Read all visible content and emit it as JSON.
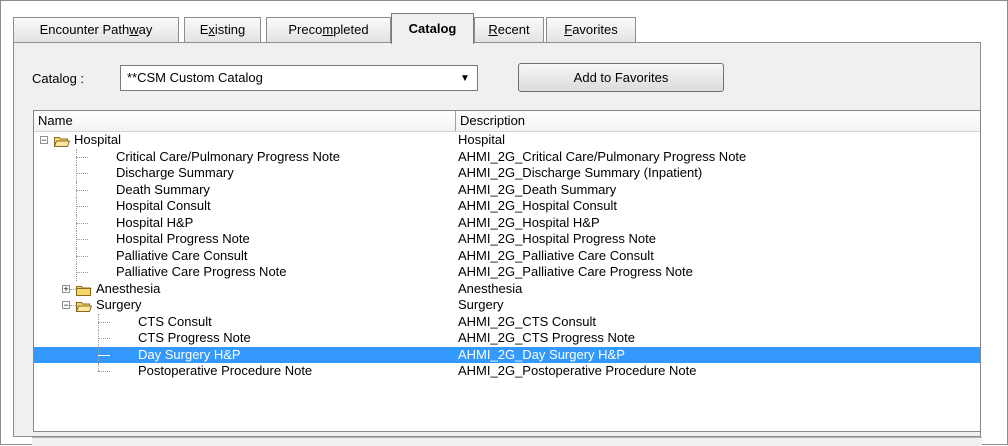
{
  "tabs": [
    {
      "pre": "Encounter Path",
      "u": "w",
      "post": "ay",
      "active": false
    },
    {
      "pre": "E",
      "u": "x",
      "post": "isting",
      "active": false
    },
    {
      "pre": "Preco",
      "u": "m",
      "post": "pleted",
      "active": false
    },
    {
      "pre": "",
      "u": "",
      "post": "Catalog",
      "active": true
    },
    {
      "pre": "",
      "u": "R",
      "post": "ecent",
      "active": false
    },
    {
      "pre": "",
      "u": "F",
      "post": "avorites",
      "active": false
    }
  ],
  "catalog": {
    "label": "Catalog :",
    "selected": "**CSM Custom Catalog",
    "add_button": "Add to Favorites"
  },
  "list": {
    "columns": [
      "Name",
      "Description"
    ],
    "rows": [
      {
        "name": "Hospital",
        "desc": "Hospital",
        "level": 0,
        "type": "folder-open",
        "expander": "-"
      },
      {
        "name": "Critical Care/Pulmonary Progress Note",
        "desc": "AHMI_2G_Critical Care/Pulmonary Progress Note",
        "level": 1,
        "type": "item"
      },
      {
        "name": "Discharge Summary",
        "desc": "AHMI_2G_Discharge Summary (Inpatient)",
        "level": 1,
        "type": "item"
      },
      {
        "name": "Death Summary",
        "desc": "AHMI_2G_Death Summary",
        "level": 1,
        "type": "item"
      },
      {
        "name": "Hospital Consult",
        "desc": "AHMI_2G_Hospital Consult",
        "level": 1,
        "type": "item"
      },
      {
        "name": "Hospital H&P",
        "desc": "AHMI_2G_Hospital H&P",
        "level": 1,
        "type": "item"
      },
      {
        "name": "Hospital Progress Note",
        "desc": "AHMI_2G_Hospital Progress Note",
        "level": 1,
        "type": "item"
      },
      {
        "name": "Palliative Care Consult",
        "desc": "AHMI_2G_Palliative Care Consult",
        "level": 1,
        "type": "item"
      },
      {
        "name": "Palliative Care Progress Note",
        "desc": "AHMI_2G_Palliative Care Progress Note",
        "level": 1,
        "type": "item"
      },
      {
        "name": "Anesthesia",
        "desc": "Anesthesia",
        "level": 1,
        "type": "folder-closed",
        "expander": "+"
      },
      {
        "name": "Surgery",
        "desc": "Surgery",
        "level": 1,
        "type": "folder-open",
        "expander": "-"
      },
      {
        "name": "CTS Consult",
        "desc": "AHMI_2G_CTS Consult",
        "level": 2,
        "type": "item"
      },
      {
        "name": "CTS Progress Note",
        "desc": "AHMI_2G_CTS Progress Note",
        "level": 2,
        "type": "item"
      },
      {
        "name": "Day Surgery H&P",
        "desc": "AHMI_2G_Day Surgery H&P",
        "level": 2,
        "type": "item",
        "selected": true
      },
      {
        "name": "Postoperative Procedure Note",
        "desc": "AHMI_2G_Postoperative Procedure Note",
        "level": 2,
        "type": "item"
      }
    ]
  },
  "colors": {
    "selection": "#3399ff",
    "folder": "#f5d76e"
  }
}
